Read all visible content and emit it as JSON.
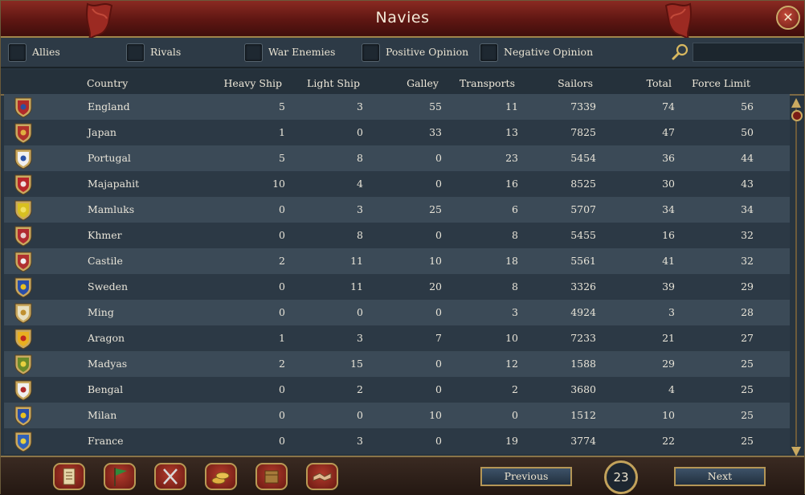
{
  "window": {
    "title": "Navies",
    "close_symbol": "✕"
  },
  "filters": [
    {
      "label": "Allies"
    },
    {
      "label": "Rivals"
    },
    {
      "label": "War Enemies"
    },
    {
      "label": "Positive Opinion"
    },
    {
      "label": "Negative Opinion"
    }
  ],
  "search": {
    "placeholder": ""
  },
  "columns": {
    "country": "Country",
    "heavy": "Heavy Ship",
    "light": "Light Ship",
    "galley": "Galley",
    "transports": "Transports",
    "sailors": "Sailors",
    "total": "Total",
    "force_limit": "Force Limit"
  },
  "rows": [
    {
      "country": "England",
      "heavy": "5",
      "light": "3",
      "galley": "55",
      "transports": "11",
      "sailors": "7339",
      "total": "74",
      "force_limit": "56",
      "flag_colors": [
        "#b02a2a",
        "#2c4fa0"
      ]
    },
    {
      "country": "Japan",
      "heavy": "1",
      "light": "0",
      "galley": "33",
      "transports": "13",
      "sailors": "7825",
      "total": "47",
      "force_limit": "50",
      "flag_colors": [
        "#b0322a",
        "#e0b040"
      ]
    },
    {
      "country": "Portugal",
      "heavy": "5",
      "light": "8",
      "galley": "0",
      "transports": "23",
      "sailors": "5454",
      "total": "36",
      "force_limit": "44",
      "flag_colors": [
        "#f0f0f0",
        "#2a52a8"
      ]
    },
    {
      "country": "Majapahit",
      "heavy": "10",
      "light": "4",
      "galley": "0",
      "transports": "16",
      "sailors": "8525",
      "total": "30",
      "force_limit": "43",
      "flag_colors": [
        "#b8262a",
        "#f0e0e0"
      ]
    },
    {
      "country": "Mamluks",
      "heavy": "0",
      "light": "3",
      "galley": "25",
      "transports": "6",
      "sailors": "5707",
      "total": "34",
      "force_limit": "34",
      "flag_colors": [
        "#d8c020",
        "#f0e060"
      ]
    },
    {
      "country": "Khmer",
      "heavy": "0",
      "light": "8",
      "galley": "0",
      "transports": "8",
      "sailors": "5455",
      "total": "16",
      "force_limit": "32",
      "flag_colors": [
        "#b02a30",
        "#e8d0d0"
      ]
    },
    {
      "country": "Castile",
      "heavy": "2",
      "light": "11",
      "galley": "10",
      "transports": "18",
      "sailors": "5561",
      "total": "41",
      "force_limit": "32",
      "flag_colors": [
        "#b03030",
        "#f0f0f0"
      ]
    },
    {
      "country": "Sweden",
      "heavy": "0",
      "light": "11",
      "galley": "20",
      "transports": "8",
      "sailors": "3326",
      "total": "39",
      "force_limit": "29",
      "flag_colors": [
        "#2a4ea8",
        "#e8c020"
      ]
    },
    {
      "country": "Ming",
      "heavy": "0",
      "light": "0",
      "galley": "0",
      "transports": "3",
      "sailors": "4924",
      "total": "3",
      "force_limit": "28",
      "flag_colors": [
        "#e8e0c0",
        "#c09030"
      ]
    },
    {
      "country": "Aragon",
      "heavy": "1",
      "light": "3",
      "galley": "7",
      "transports": "10",
      "sailors": "7233",
      "total": "21",
      "force_limit": "27",
      "flag_colors": [
        "#e8b020",
        "#c0281e"
      ]
    },
    {
      "country": "Madyas",
      "heavy": "2",
      "light": "15",
      "galley": "0",
      "transports": "12",
      "sailors": "1588",
      "total": "29",
      "force_limit": "25",
      "flag_colors": [
        "#6a8a2a",
        "#e8d040"
      ]
    },
    {
      "country": "Bengal",
      "heavy": "0",
      "light": "2",
      "galley": "0",
      "transports": "2",
      "sailors": "3680",
      "total": "4",
      "force_limit": "25",
      "flag_colors": [
        "#f0f0f0",
        "#b02a2a"
      ]
    },
    {
      "country": "Milan",
      "heavy": "0",
      "light": "0",
      "galley": "10",
      "transports": "0",
      "sailors": "1512",
      "total": "10",
      "force_limit": "25",
      "flag_colors": [
        "#2a4ea8",
        "#e8c020"
      ]
    },
    {
      "country": "France",
      "heavy": "0",
      "light": "3",
      "galley": "0",
      "transports": "19",
      "sailors": "3774",
      "total": "22",
      "force_limit": "25",
      "flag_colors": [
        "#3060b8",
        "#e8d040"
      ]
    }
  ],
  "pagination": {
    "previous": "Previous",
    "next": "Next",
    "page": "23"
  },
  "bottom_tabs": [
    {
      "name": "ledger-tab-icon"
    },
    {
      "name": "flag-tab-icon"
    },
    {
      "name": "crossed-swords-tab-icon"
    },
    {
      "name": "coins-tab-icon"
    },
    {
      "name": "crate-tab-icon"
    },
    {
      "name": "handshake-tab-icon"
    }
  ],
  "colors": {
    "accent_red": "#6e1a14",
    "gold_border": "#b99a55",
    "row_odd": "#3b4a57",
    "row_even": "#2c3945"
  }
}
